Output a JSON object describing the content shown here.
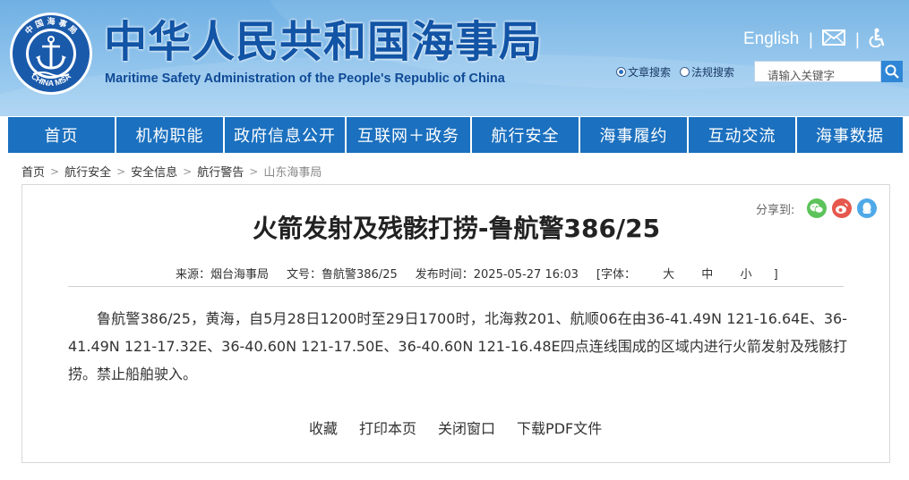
{
  "header": {
    "title": "中华人民共和国海事局",
    "subtitle": "Maritime Safety Administration of the People's Republic of China",
    "emblem_top_text": "中 国 海 事 局",
    "emblem_bottom_text": "CHINA MSA",
    "english_link": "English",
    "separator": "|",
    "icons": [
      "mail-icon",
      "accessibility-icon"
    ]
  },
  "search": {
    "option_article": "文章搜索",
    "option_law": "法规搜索",
    "selected": "文章搜索",
    "placeholder": "请输入关键字"
  },
  "nav": {
    "items": [
      {
        "label": "首页"
      },
      {
        "label": "机构职能"
      },
      {
        "label": "政府信息公开"
      },
      {
        "label": "互联网＋政务"
      },
      {
        "label": "航行安全"
      },
      {
        "label": "海事履约"
      },
      {
        "label": "互动交流"
      },
      {
        "label": "海事数据"
      }
    ]
  },
  "breadcrumb": {
    "items": [
      "首页",
      "航行安全",
      "安全信息",
      "航行警告",
      "山东海事局"
    ],
    "separator": ">"
  },
  "share": {
    "label": "分享到:",
    "icons": [
      "wechat-icon",
      "weibo-icon",
      "qq-icon"
    ]
  },
  "article": {
    "title": "火箭发射及残骸打捞-鲁航警386/25",
    "source": "来源：烟台海事局",
    "doc_no": "文号：鲁航警386/25",
    "published": "发布时间：2025-05-27 16:03",
    "font_size_label": "[字体：",
    "font_large": "大",
    "font_medium": "中",
    "font_small": "小",
    "font_size_close": "]",
    "body": "鲁航警386/25，黄海，自5月28日1200时至29日1700时，北海救201、航顺06在由36-41.49N 121-16.64E、36-41.49N 121-17.32E、36-40.60N 121-17.50E、36-40.60N 121-16.48E四点连线围成的区域内进行火箭发射及残骸打捞。禁止船舶驶入。"
  },
  "actions": {
    "favorite": "收藏",
    "print": "打印本页",
    "close": "关闭窗口",
    "download": "下载PDF文件"
  },
  "colors": {
    "nav_bg": "#1b70bf",
    "title_blue": "#1254a5",
    "header_bg": "#8fc3ec",
    "wechat": "#5cc35a",
    "weibo": "#e6574d",
    "qq": "#4fa9e8"
  }
}
